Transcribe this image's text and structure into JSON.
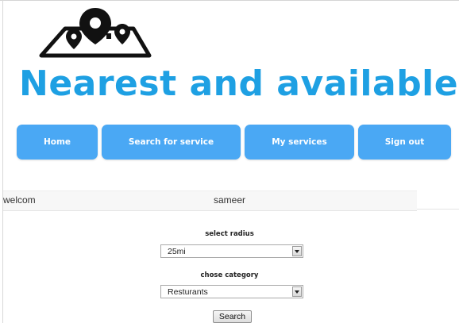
{
  "header": {
    "logo_icon": "map-pins-icon",
    "title": "Nearest and available"
  },
  "nav": {
    "items": [
      {
        "label": "Home"
      },
      {
        "label": "Search for service"
      },
      {
        "label": "My services"
      },
      {
        "label": "Sign out"
      }
    ],
    "color": "#4aa8f4"
  },
  "welcome": {
    "label": "welcom",
    "username": "sameer"
  },
  "form": {
    "radius": {
      "label": "select radius",
      "selected": "25mi"
    },
    "category": {
      "label": "chose category",
      "selected": "Resturants"
    },
    "submit_label": "Search"
  },
  "colors": {
    "title": "#1ea0e3",
    "nav_button": "#4aa8f4"
  }
}
